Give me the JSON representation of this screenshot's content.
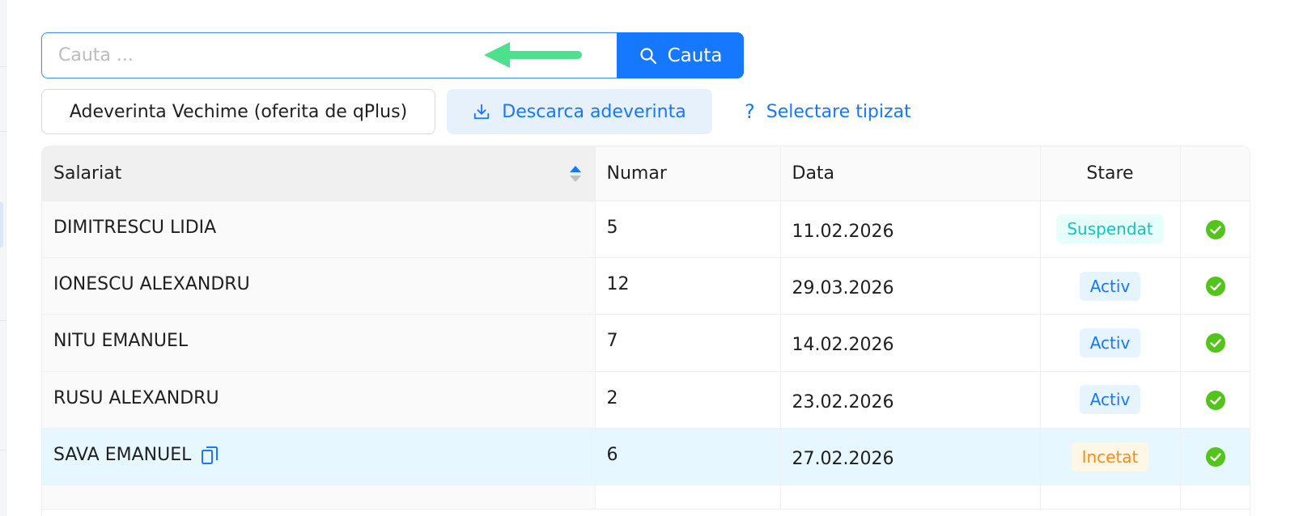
{
  "search": {
    "placeholder": "Cauta ...",
    "button_label": "Cauta"
  },
  "toolbar": {
    "adeverinta_label": "Adeverinta Vechime (oferita de qPlus)",
    "descarca_label": "Descarca adeverinta",
    "selectare_label": "Selectare tipizat"
  },
  "table": {
    "columns": {
      "salariat": "Salariat",
      "numar": "Numar",
      "data": "Data",
      "stare": "Stare"
    },
    "rows": [
      {
        "salariat": "DIMITRESCU LIDIA",
        "numar": "5",
        "data": "11.02.2026",
        "stare": "Suspendat"
      },
      {
        "salariat": "IONESCU ALEXANDRU",
        "numar": "12",
        "data": "29.03.2026",
        "stare": "Activ"
      },
      {
        "salariat": "NITU EMANUEL",
        "numar": "7",
        "data": "14.02.2026",
        "stare": "Activ"
      },
      {
        "salariat": "RUSU ALEXANDRU",
        "numar": "2",
        "data": "23.02.2026",
        "stare": "Activ"
      },
      {
        "salariat": "SAVA EMANUEL",
        "numar": "6",
        "data": "27.02.2026",
        "stare": "Incetat"
      }
    ]
  },
  "icons": {
    "search_button": "search-icon",
    "descarca": "download-icon",
    "selectare": "question-icon",
    "sort": "sort-icon",
    "row_copy": "copy-icon",
    "row_status": "check-circle-icon",
    "overlay": "arrow-left-icon"
  },
  "colors": {
    "primary": "#1677ff",
    "tag_suspendat_bg": "#e6fffb",
    "tag_suspendat_text": "#13c2c2",
    "tag_activ_bg": "#e6f4ff",
    "tag_activ_text": "#1677ff",
    "tag_incetat_bg": "#fff7e6",
    "tag_incetat_text": "#fa8c16",
    "check": "#52c41a",
    "highlight_row": "#e6f7ff",
    "arrow": "#4ee08c"
  }
}
